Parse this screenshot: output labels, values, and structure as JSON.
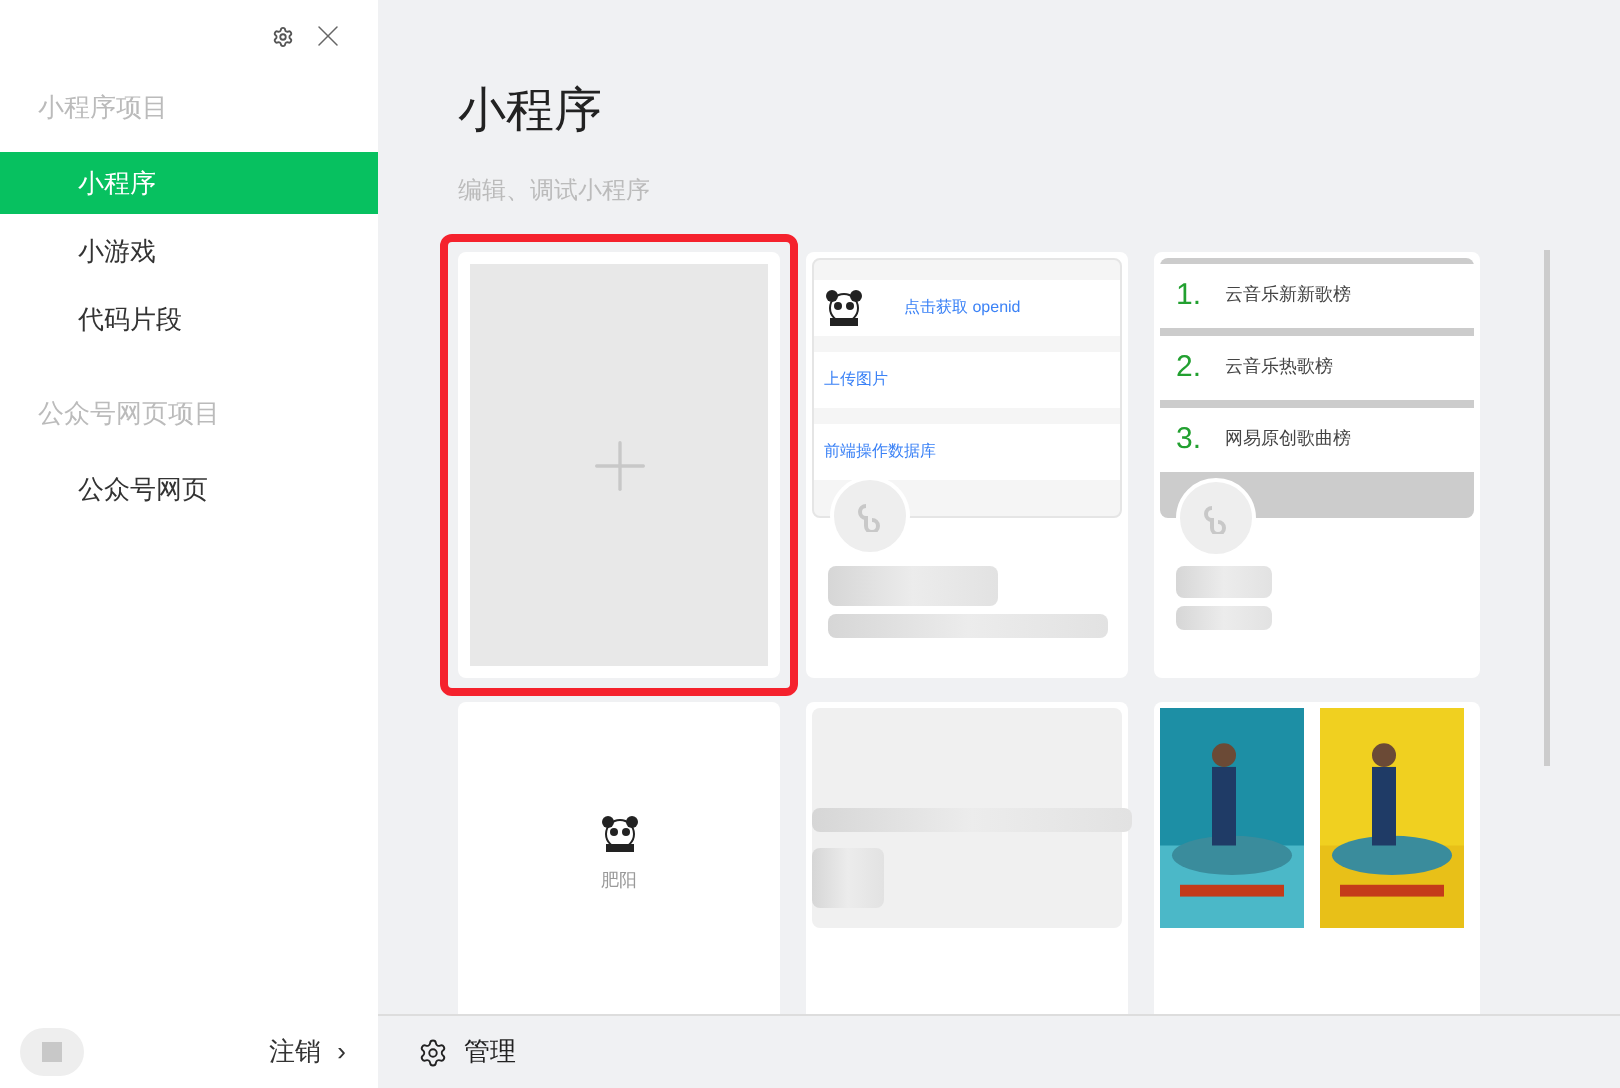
{
  "sidebar": {
    "groups": [
      {
        "heading": "小程序项目",
        "items": [
          {
            "label": "小程序",
            "selected": true
          },
          {
            "label": "小游戏",
            "selected": false
          },
          {
            "label": "代码片段",
            "selected": false
          }
        ]
      },
      {
        "heading": "公众号网页项目",
        "items": [
          {
            "label": "公众号网页",
            "selected": false
          }
        ]
      }
    ],
    "logout": "注销",
    "logout_arrow": "›"
  },
  "main": {
    "title": "小程序",
    "subtitle": "编辑、调试小程序",
    "manage": "管理",
    "projects": [
      {
        "kind": "new",
        "selected": true
      },
      {
        "kind": "list",
        "selected": false,
        "rows": [
          "点击获取 openid",
          "上传图片",
          "前端操作数据库"
        ]
      },
      {
        "kind": "ranking",
        "selected": false,
        "rows": [
          {
            "rank": "1.",
            "label": "云音乐新新歌榜"
          },
          {
            "rank": "2.",
            "label": "云音乐热歌榜"
          },
          {
            "rank": "3.",
            "label": "网易原创歌曲榜"
          }
        ]
      },
      {
        "kind": "avatar",
        "selected": false,
        "caption": "肥阳"
      },
      {
        "kind": "blank",
        "selected": false
      },
      {
        "kind": "posters",
        "selected": false
      }
    ]
  }
}
